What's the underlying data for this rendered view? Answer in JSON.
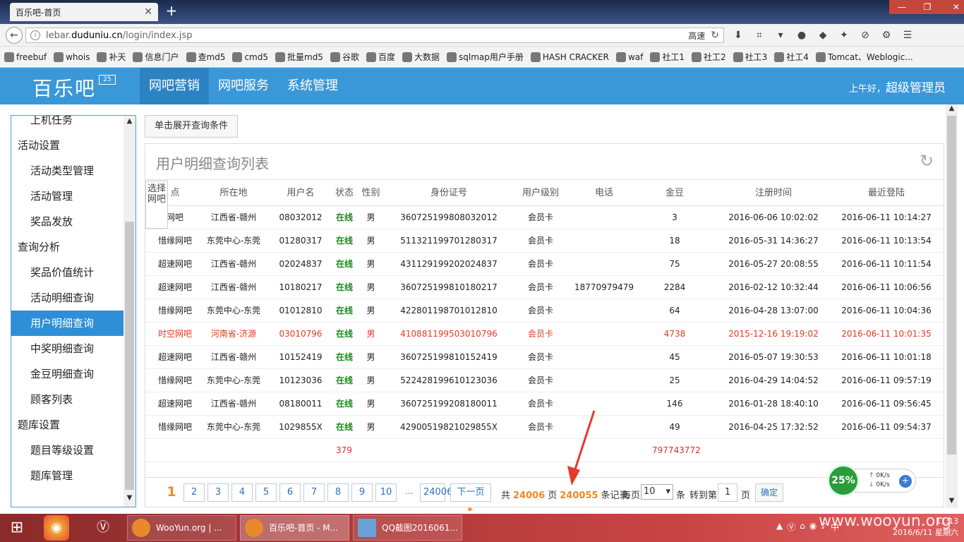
{
  "browser": {
    "tab_title": "百乐吧-首页",
    "url_prefix": "lebar.",
    "url_domain": "duduniu.cn",
    "url_path": "/login/index.jsp",
    "speed_label": "高速",
    "bookmarks": [
      "freebuf",
      "whois",
      "补天",
      "信息门户",
      "查md5",
      "cmd5",
      "批量md5",
      "谷歌",
      "百度",
      "大数据",
      "sqlmap用户手册",
      "HASH CRACKER",
      "waf",
      "社工1",
      "社工2",
      "社工3",
      "社工4",
      "Tomcat、Weblogic..."
    ]
  },
  "header": {
    "logo": "百乐吧",
    "badge": "25",
    "nav": [
      "网吧营销",
      "网吧服务",
      "系统管理"
    ],
    "greeting_prefix": "上午好，",
    "greeting_user": "超级管理员"
  },
  "sidebar": {
    "items": [
      {
        "label": "上机任务",
        "type": "item"
      },
      {
        "label": "活动设置",
        "type": "group"
      },
      {
        "label": "活动类型管理",
        "type": "item"
      },
      {
        "label": "活动管理",
        "type": "item"
      },
      {
        "label": "奖品发放",
        "type": "item"
      },
      {
        "label": "查询分析",
        "type": "group"
      },
      {
        "label": "奖品价值统计",
        "type": "item"
      },
      {
        "label": "活动明细查询",
        "type": "item"
      },
      {
        "label": "用户明细查询",
        "type": "item",
        "active": true
      },
      {
        "label": "中奖明细查询",
        "type": "item"
      },
      {
        "label": "金豆明细查询",
        "type": "item"
      },
      {
        "label": "顾客列表",
        "type": "item"
      },
      {
        "label": "题库设置",
        "type": "group"
      },
      {
        "label": "题目等级设置",
        "type": "item"
      },
      {
        "label": "题库管理",
        "type": "item"
      }
    ]
  },
  "main": {
    "expand_button": "单击展开查询条件",
    "panel_title": "用户明细查询列表",
    "select_label": "选择网吧",
    "columns": [
      "点",
      "所在地",
      "用户名",
      "状态",
      "性别",
      "身份证号",
      "用户级别",
      "电话",
      "金豆",
      "注册时间",
      "最近登陆"
    ],
    "rows": [
      [
        "网吧",
        "江西省-赣州",
        "08032012",
        "在线",
        "男",
        "360725199808032012",
        "会员卡",
        "",
        "3",
        "2016-06-06 10:02:02",
        "2016-06-11 10:14:27"
      ],
      [
        "惜缘网吧",
        "东莞中心-东莞",
        "01280317",
        "在线",
        "男",
        "511321199701280317",
        "会员卡",
        "",
        "18",
        "2016-05-31 14:36:27",
        "2016-06-11 10:13:54"
      ],
      [
        "超速网吧",
        "江西省-赣州",
        "02024837",
        "在线",
        "男",
        "431129199202024837",
        "会员卡",
        "",
        "75",
        "2016-05-27 20:08:55",
        "2016-06-11 10:11:54"
      ],
      [
        "超速网吧",
        "江西省-赣州",
        "10180217",
        "在线",
        "男",
        "360725199810180217",
        "会员卡",
        "18770979479",
        "2284",
        "2016-02-12 10:32:44",
        "2016-06-11 10:06:56"
      ],
      [
        "惜缘网吧",
        "东莞中心-东莞",
        "01012810",
        "在线",
        "男",
        "422801198701012810",
        "会员卡",
        "",
        "64",
        "2016-04-28 13:07:00",
        "2016-06-11 10:04:36"
      ],
      [
        "时空网吧",
        "河南省-济源",
        "03010796",
        "在线",
        "男",
        "410881199503010796",
        "会员卡",
        "",
        "4738",
        "2015-12-16 19:19:02",
        "2016-06-11 10:01:35"
      ],
      [
        "超速网吧",
        "江西省-赣州",
        "10152419",
        "在线",
        "男",
        "360725199810152419",
        "会员卡",
        "",
        "45",
        "2016-05-07 19:30:53",
        "2016-06-11 10:01:18"
      ],
      [
        "惜缘网吧",
        "东莞中心-东莞",
        "10123036",
        "在线",
        "男",
        "522428199610123036",
        "会员卡",
        "",
        "25",
        "2016-04-29 14:04:52",
        "2016-06-11 09:57:19"
      ],
      [
        "超速网吧",
        "江西省-赣州",
        "08180011",
        "在线",
        "男",
        "360725199208180011",
        "会员卡",
        "",
        "146",
        "2016-01-28 18:40:10",
        "2016-06-11 09:56:45"
      ],
      [
        "惜缘网吧",
        "东莞中心-东莞",
        "1029855X",
        "在线",
        "男",
        "42900519821029855X",
        "会员卡",
        "",
        "49",
        "2016-04-25 17:32:52",
        "2016-06-11 09:54:37"
      ]
    ],
    "highlight_row": 5,
    "sum_left": "379",
    "sum_right": "797743772"
  },
  "pager": {
    "current": "1",
    "pages": [
      "2",
      "3",
      "4",
      "5",
      "6",
      "7",
      "8",
      "9",
      "10"
    ],
    "ellipsis": "...",
    "last": "24006",
    "next": "下一页",
    "total_prefix": "共",
    "total_pages": "24006",
    "page_unit": "页",
    "total_records": "240055",
    "records_suffix": "条记录",
    "per_page_label": "每页",
    "per_page_value": "10",
    "per_page_unit": "条",
    "goto_label": "转到第",
    "goto_value": "1",
    "goto_unit": "页",
    "confirm": "确定"
  },
  "netwidget": {
    "percent": "25%",
    "up": "0K/s",
    "down": "0K/s"
  },
  "taskbar": {
    "tasks": [
      "WooYun.org | ...",
      "百乐吧-首页 - M...",
      "QQ截图2016061..."
    ],
    "time": "11:13",
    "date": "2016/6/11 星期六"
  },
  "watermark": "www.wooyun.org"
}
